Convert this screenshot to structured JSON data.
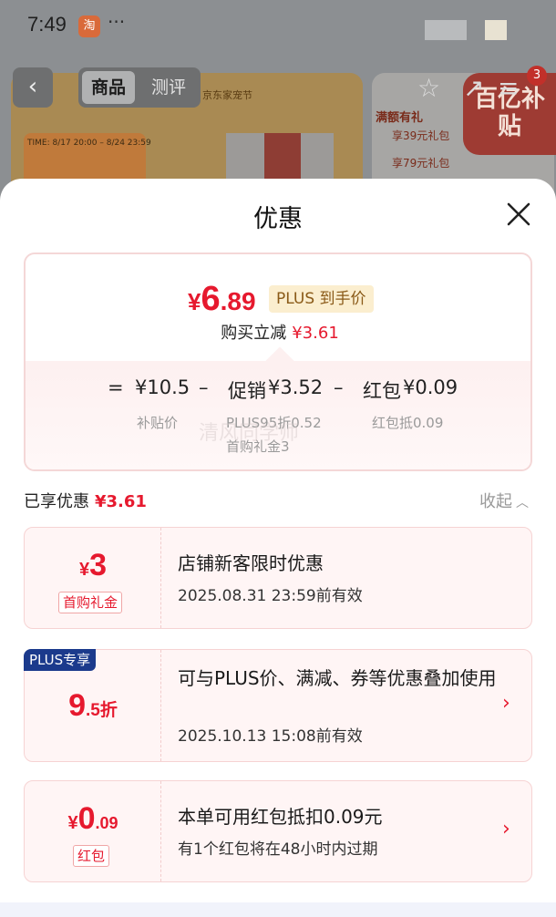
{
  "status_bar": {
    "time": "7:49",
    "app_icon_text": "淘",
    "more": "···"
  },
  "background": {
    "tabs": [
      {
        "label": "商品"
      },
      {
        "label": "测评"
      }
    ],
    "promo_festival": "京东家宠节",
    "promo_time": "TIME: 8/17 20:00 – 8/24 23:59",
    "side_card_title": "满额有礼",
    "side_card_line1": "享39元礼包",
    "side_card_line2": "享79元礼包",
    "subsidy_label": "百亿补贴",
    "cart_badge": "3"
  },
  "sheet": {
    "title": "优惠",
    "summary": {
      "currency": "¥",
      "final_price_int": "6",
      "final_price_dec": ".89",
      "plus_tag": "PLUS 到手价",
      "buy_reduce_label": "购买立减",
      "buy_reduce_amount": "¥3.61",
      "equals": "=",
      "base_price": "¥10.5",
      "minus1": "–",
      "promo_label": "促销",
      "promo_amount": "¥3.52",
      "minus2": "–",
      "redpacket_label": "红包",
      "redpacket_amount": "¥0.09",
      "sub_base": "补贴价",
      "sub_promo_line1": "PLUS95折0.52",
      "sub_promo_line2": "首购礼金3",
      "sub_redpacket": "红包抵0.09",
      "watermark": "清风同学师"
    },
    "enjoyed": {
      "label": "已享优惠",
      "amount": "¥3.61",
      "collapse_label": "收起"
    },
    "coupons": [
      {
        "currency": "¥",
        "amount": "3",
        "amount_dec": "",
        "tag": "首购礼金",
        "title": "店铺新客限时优惠",
        "subtitle": "2025.08.31 23:59前有效"
      },
      {
        "ribbon": "PLUS专享",
        "amount": "9",
        "amount_dec": ".5折",
        "title": "可与PLUS价、满减、券等优惠叠加使用",
        "subtitle": "2025.10.13 15:08前有效",
        "arrow": "›"
      },
      {
        "currency": "¥",
        "amount": "0",
        "amount_dec": ".09",
        "tag": "红包",
        "title": "本单可用红包抵扣0.09元",
        "subtitle": "有1个红包将在48小时内过期",
        "arrow": "›"
      }
    ]
  },
  "colors": {
    "accent_red": "#e6192e",
    "plus_blue": "#1b3a8c",
    "plus_gold_bg": "#fbeecf"
  }
}
